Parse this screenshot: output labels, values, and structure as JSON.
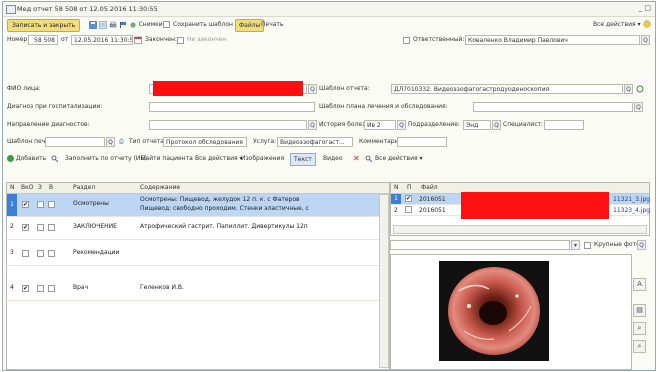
{
  "window": {
    "title": "Мед отчет 58 508 от 12.05.2016 11:30:55",
    "controls": "_ □"
  },
  "toolbar": {
    "save_close": "Записать и закрыть",
    "snapshots": "Снимки",
    "save_template": "Сохранить шаблон",
    "files": "Файлы",
    "print": "Печать",
    "all_actions": "Все действия ▾"
  },
  "header": {
    "number_label": "Номер:",
    "number_value": "58 508",
    "date_label": "от",
    "date_value": "12.05.2016 11:30:55",
    "closed_label": "Закончен:",
    "not_closed": "Не закончен",
    "responsible_label": "Ответственный:",
    "responsible_value": "Коваленко Владимир Павлович"
  },
  "form": {
    "patient_label": "ФИО лица:",
    "template_label": "Шаблон отчета:",
    "template_value": "ДЛ7010332: Видеоэзофагогастродуоденоскопия",
    "diagnosis_label": "Диагноз при госпитализации:",
    "plan_label": "Шаблон плана лечения и обследования:",
    "referral_label": "Направление диагностов:",
    "history_label": "История болезни:",
    "history_value": "Ив 2",
    "department_label": "Подразделение:",
    "department_value": "Энд",
    "specialist_label": "Специалист:",
    "print_template_label": "Шаблон печати:",
    "report_type_label": "Тип отчета:",
    "report_type_value": "Протокол обследования",
    "service_label": "Услуга:",
    "service_value": "Видеоэзофагогаст...",
    "comment_label": "Комментарий:"
  },
  "grid_toolbar": {
    "add": "Добавить",
    "fill_report": "Заполнить по отчету (ИБ)",
    "find_patient": "Найти пациента",
    "all_actions": "Все действия ▾",
    "images": "Изображения",
    "text": "Текст",
    "video": "Видео",
    "all_actions_right": "Все действия ▾"
  },
  "table": {
    "columns": [
      "N",
      "ВкО",
      "З",
      "В",
      "Раздел",
      "Содержание"
    ],
    "rows": [
      {
        "n": "1",
        "checked": true,
        "section": "Осмотрены",
        "content": "Осмотрены: Пищевод, желудок 12 п. к. с Фатеров",
        "content2": "Пищевод: свободно проходим. Стенки эластичные, с",
        "selected": true
      },
      {
        "n": "2",
        "checked": true,
        "section": "ЗАКЛЮЧЕНИЕ",
        "content": "Атрофический гастрит. Папиллит. Дивертикулы 12п",
        "content2": "",
        "selected": false
      },
      {
        "n": "3",
        "checked": false,
        "section": "Рекомендации",
        "content": "",
        "content2": "",
        "selected": false
      },
      {
        "n": "4",
        "checked": true,
        "section": "Врач",
        "content": "Геленков И.В.",
        "content2": "",
        "selected": false
      }
    ]
  },
  "files": {
    "columns": [
      "N",
      "П",
      "Файл"
    ],
    "rows": [
      {
        "n": "1",
        "checked": true,
        "name_start": "2016051",
        "name_end": "11321_3.jpg",
        "selected": true
      },
      {
        "n": "2",
        "checked": false,
        "name_start": "2016051",
        "name_end": "11323_4.jpg",
        "selected": false
      }
    ],
    "large_view": "Крупные фото"
  },
  "colors": {
    "accent": "#f3dc7a",
    "selection": "#bcd6f3",
    "redaction": "#ff1010"
  }
}
